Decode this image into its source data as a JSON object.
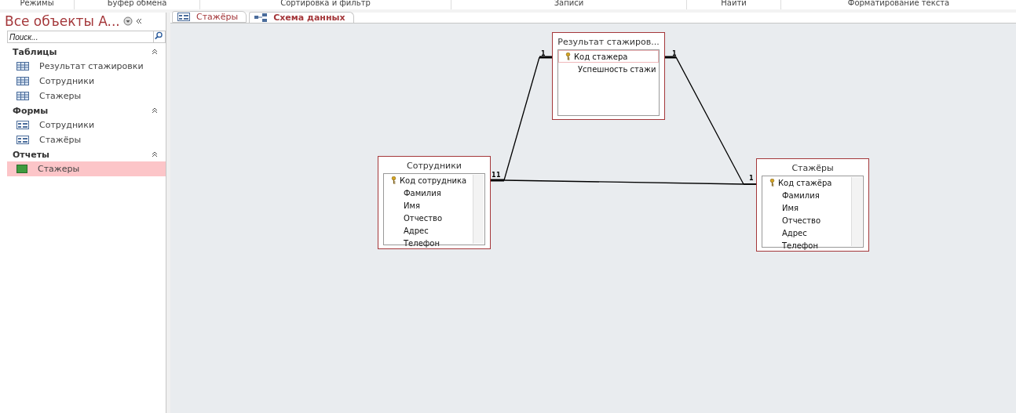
{
  "ribbon_groups": [
    "Режимы",
    "Буфер обмена",
    "Сортировка и фильтр",
    "Записи",
    "Найти",
    "Форматирование текста"
  ],
  "nav": {
    "title": "Все объекты A...",
    "search": {
      "placeholder": "Поиск..."
    },
    "sections": [
      {
        "title": "Таблицы",
        "items": [
          {
            "label": "Результат стажировки",
            "kind": "table",
            "selected": false
          },
          {
            "label": "Сотрудники",
            "kind": "table",
            "selected": false
          },
          {
            "label": "Стажеры",
            "kind": "table",
            "selected": false
          }
        ]
      },
      {
        "title": "Формы",
        "items": [
          {
            "label": "Сотрудники",
            "kind": "form",
            "selected": false
          },
          {
            "label": "Стажёры",
            "kind": "form",
            "selected": false
          }
        ]
      },
      {
        "title": "Отчеты",
        "items": [
          {
            "label": "Стажеры",
            "kind": "report",
            "selected": true
          }
        ]
      }
    ]
  },
  "tabs": [
    {
      "label": "Стажёры",
      "kind": "form",
      "selected": false
    },
    {
      "label": "Схема данных",
      "kind": "schema",
      "selected": true
    }
  ],
  "tables": [
    {
      "title": "Результат стажиров...",
      "scrollbar": false,
      "fields": [
        {
          "name": "Код стажера",
          "key": true,
          "selected": true
        },
        {
          "name": "Успешность стажи",
          "key": false,
          "selected": false
        }
      ]
    },
    {
      "title": "Сотрудники",
      "scrollbar": true,
      "fields": [
        {
          "name": "Код сотрудника",
          "key": true,
          "selected": false
        },
        {
          "name": "Фамилия",
          "key": false,
          "selected": false
        },
        {
          "name": "Имя",
          "key": false,
          "selected": false
        },
        {
          "name": "Отчество",
          "key": false,
          "selected": false
        },
        {
          "name": "Адрес",
          "key": false,
          "selected": false
        },
        {
          "name": "Телефон",
          "key": false,
          "selected": false
        }
      ]
    },
    {
      "title": "Стажёры",
      "scrollbar": true,
      "fields": [
        {
          "name": "Код стажёра",
          "key": true,
          "selected": false
        },
        {
          "name": "Фамилия",
          "key": false,
          "selected": false
        },
        {
          "name": "Имя",
          "key": false,
          "selected": false
        },
        {
          "name": "Отчество",
          "key": false,
          "selected": false
        },
        {
          "name": "Адрес",
          "key": false,
          "selected": false
        },
        {
          "name": "Телефон",
          "key": false,
          "selected": false
        }
      ]
    }
  ],
  "relationships": [
    {
      "from_label": "1",
      "to_label": "1"
    },
    {
      "from_label": "1"
    },
    {
      "from_label": "1",
      "to_label": "1"
    }
  ]
}
